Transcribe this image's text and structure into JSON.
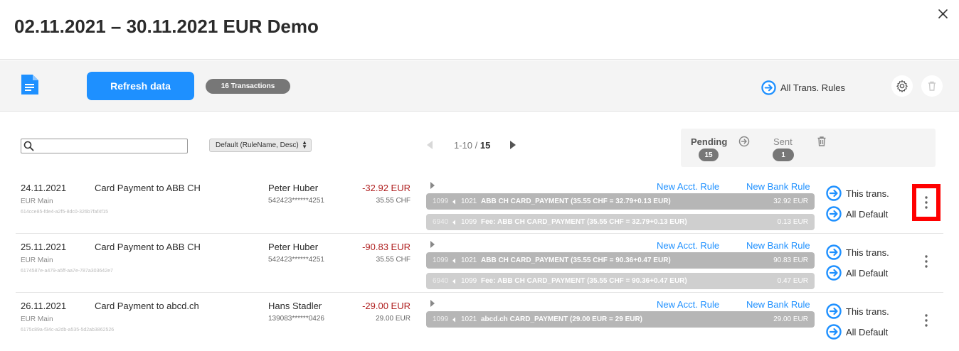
{
  "header": {
    "title": "02.11.2021 – 30.11.2021 EUR Demo"
  },
  "toolbar": {
    "refresh_label": "Refresh data",
    "transactions_badge": "16 Transactions",
    "all_rules_label": "All Trans. Rules"
  },
  "filters": {
    "search_value": "",
    "sort_selected": "Default (RuleName, Desc)"
  },
  "pager": {
    "range": "1-10",
    "separator": " / ",
    "total": "15"
  },
  "status": {
    "pending_label": "Pending",
    "pending_count": "15",
    "sent_label": "Sent",
    "sent_count": "1"
  },
  "row_labels": {
    "new_acct_rule": "New Acct. Rule",
    "new_bank_rule": "New Bank Rule",
    "this_trans": "This trans.",
    "all_default": "All Default"
  },
  "transactions": [
    {
      "date": "24.11.2021",
      "account": "EUR Main",
      "id": "614cce85-fde4-a2f5-8dc0-326b7faf4f15",
      "description": "Card Payment to ABB CH",
      "person": "Peter Huber",
      "card": "542423******4251",
      "amount": "-32.92 EUR",
      "original": "35.55 CHF",
      "bookings": [
        {
          "debit": "1099",
          "credit": "1021",
          "text": "ABB CH CARD_PAYMENT (35.55 CHF = 32.79+0.13 EUR)",
          "amount": "32.92 EUR"
        },
        {
          "debit": "6940",
          "credit": "1099",
          "text": "Fee: ABB CH CARD_PAYMENT (35.55 CHF = 32.79+0.13 EUR)",
          "amount": "0.13 EUR"
        }
      ]
    },
    {
      "date": "25.11.2021",
      "account": "EUR Main",
      "id": "6174587e-a479-a5ff-aa7e-787a303642e7",
      "description": "Card Payment to ABB CH",
      "person": "Peter Huber",
      "card": "542423******4251",
      "amount": "-90.83 EUR",
      "original": "35.55 CHF",
      "bookings": [
        {
          "debit": "1099",
          "credit": "1021",
          "text": "ABB CH CARD_PAYMENT (35.55 CHF = 90.36+0.47 EUR)",
          "amount": "90.83 EUR"
        },
        {
          "debit": "6940",
          "credit": "1099",
          "text": "Fee: ABB CH CARD_PAYMENT (35.55 CHF = 90.36+0.47 EUR)",
          "amount": "0.47 EUR"
        }
      ]
    },
    {
      "date": "26.11.2021",
      "account": "EUR Main",
      "id": "6175c89a-f34c-a2db-a535-5d2ab3862526",
      "description": "Card Payment to abcd.ch",
      "person": "Hans Stadler",
      "card": "139083******0426",
      "amount": "-29.00 EUR",
      "original": "29.00 EUR",
      "bookings": [
        {
          "debit": "1099",
          "credit": "1021",
          "text": "abcd.ch CARD_PAYMENT (29.00 EUR = 29 EUR)",
          "amount": "29.00 EUR"
        }
      ]
    }
  ],
  "colors": {
    "accent": "#1e90ff",
    "negative": "#b02020",
    "badge": "#777777",
    "highlight": "#ff0000"
  }
}
